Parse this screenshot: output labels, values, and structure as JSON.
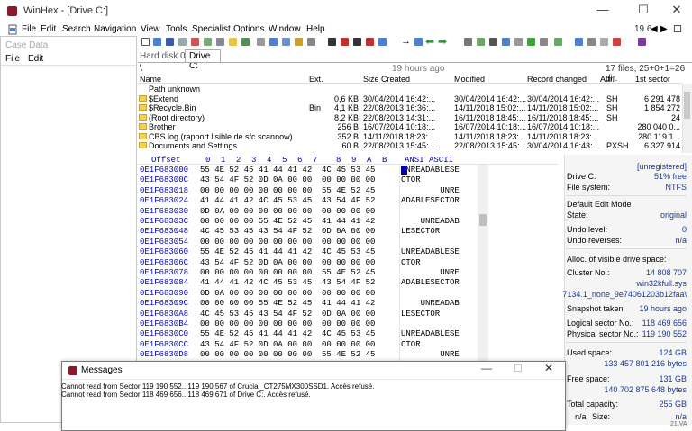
{
  "window": {
    "title": "WinHex - [Drive C:]",
    "minimize": "—",
    "maximize": "☐",
    "close": "✕"
  },
  "menu": [
    "File",
    "Edit",
    "Search",
    "Navigation",
    "View",
    "Tools",
    "Specialist",
    "Options",
    "Window",
    "Help"
  ],
  "version": "19.6",
  "case_data": {
    "title": "Case Data",
    "file": "File",
    "edit": "Edit"
  },
  "tabs": [
    "Hard disk 0",
    "Drive C:"
  ],
  "path": {
    "back": "\\",
    "time": "19 hours ago",
    "summary": "17 files, 25+0+1=26 dir."
  },
  "dir_columns": [
    "Name",
    "Ext.",
    "Size",
    "Created",
    "Modified",
    "Record changed",
    "Attr.",
    "1st sector"
  ],
  "dir_rows": [
    {
      "name": "Path unknown",
      "ext": "",
      "size": "",
      "created": "",
      "modified": "",
      "changed": "",
      "attr": "",
      "sector": "",
      "folder": false
    },
    {
      "name": "$Extend",
      "ext": "",
      "size": "0,6 KB",
      "created": "30/04/2014  16:42:...",
      "modified": "30/04/2014  16:42:...",
      "changed": "30/04/2014  16:42:...",
      "attr": "SH",
      "sector": "6 291 478",
      "folder": true
    },
    {
      "name": "$Recycle.Bin",
      "ext": "Bin",
      "size": "4,1 KB",
      "created": "22/08/2013  16:36:...",
      "modified": "14/11/2018  15:02:...",
      "changed": "14/11/2018  15:02:...",
      "attr": "SH",
      "sector": "1 854 272",
      "folder": true
    },
    {
      "name": "(Root directory)",
      "ext": "",
      "size": "8,2 KB",
      "created": "22/08/2013  14:31:...",
      "modified": "16/11/2018  18:45:...",
      "changed": "16/11/2018  18:45:...",
      "attr": "SH",
      "sector": "24",
      "folder": true
    },
    {
      "name": "Brother",
      "ext": "",
      "size": "256 B",
      "created": "16/07/2014  10:18:...",
      "modified": "16/07/2014  10:18:...",
      "changed": "16/07/2014  10:18:...",
      "attr": "",
      "sector": "280 040 0...",
      "folder": true
    },
    {
      "name": "CBS log (rapport lisible de sfc scannow)",
      "ext": "",
      "size": "352 B",
      "created": "14/11/2018  18:23:...",
      "modified": "14/11/2018  18:23:...",
      "changed": "14/11/2018  18:23:...",
      "attr": "",
      "sector": "280 119 1...",
      "folder": true
    },
    {
      "name": "Documents and Settings",
      "ext": "",
      "size": "60 B",
      "created": "22/08/2013  15:45:...",
      "modified": "22/08/2013  15:45:...",
      "changed": "30/04/2014  16:43:...",
      "attr": "PXSH",
      "sector": "6 327 914",
      "folder": true
    }
  ],
  "hex_header": {
    "offset": "Offset",
    "cols": [
      "0",
      "1",
      "2",
      "3",
      "4",
      "5",
      "6",
      "7",
      "8",
      "9",
      "A",
      "B"
    ],
    "ascii": "ANSI ASCII"
  },
  "hex_rows": [
    {
      "off": "0E1F683000",
      "hex": "55 4E 52 45 41 44 41 42  4C 45 53 45",
      "asc": "UNREADABLESE"
    },
    {
      "off": "0E1F68300C",
      "hex": "43 54 4F 52 0D 0A 00 00  00 00 00 00",
      "asc": "CTOR"
    },
    {
      "off": "0E1F683018",
      "hex": "00 00 00 00 00 00 00 00  55 4E 52 45",
      "asc": "        UNRE"
    },
    {
      "off": "0E1F683024",
      "hex": "41 44 41 42 4C 45 53 45  43 54 4F 52",
      "asc": "ADABLESECTOR"
    },
    {
      "off": "0E1F683030",
      "hex": "0D 0A 00 00 00 00 00 00  00 00 00 00",
      "asc": ""
    },
    {
      "off": "0E1F68303C",
      "hex": "00 00 00 00 55 4E 52 45  41 44 41 42",
      "asc": "    UNREADAB"
    },
    {
      "off": "0E1F683048",
      "hex": "4C 45 53 45 43 54 4F 52  0D 0A 00 00",
      "asc": "LESECTOR"
    },
    {
      "off": "0E1F683054",
      "hex": "00 00 00 00 00 00 00 00  00 00 00 00",
      "asc": ""
    },
    {
      "off": "0E1F683060",
      "hex": "55 4E 52 45 41 44 41 42  4C 45 53 45",
      "asc": "UNREADABLESE"
    },
    {
      "off": "0E1F68306C",
      "hex": "43 54 4F 52 0D 0A 00 00  00 00 00 00",
      "asc": "CTOR"
    },
    {
      "off": "0E1F683078",
      "hex": "00 00 00 00 00 00 00 00  55 4E 52 45",
      "asc": "        UNRE"
    },
    {
      "off": "0E1F683084",
      "hex": "41 44 41 42 4C 45 53 45  43 54 4F 52",
      "asc": "ADABLESECTOR"
    },
    {
      "off": "0E1F683090",
      "hex": "0D 0A 00 00 00 00 00 00  00 00 00 00",
      "asc": ""
    },
    {
      "off": "0E1F68309C",
      "hex": "00 00 00 00 55 4E 52 45  41 44 41 42",
      "asc": "    UNREADAB"
    },
    {
      "off": "0E1F6830A8",
      "hex": "4C 45 53 45 43 54 4F 52  0D 0A 00 00",
      "asc": "LESECTOR"
    },
    {
      "off": "0E1F6830B4",
      "hex": "00 00 00 00 00 00 00 00  00 00 00 00",
      "asc": ""
    },
    {
      "off": "0E1F6830C0",
      "hex": "55 4E 52 45 41 44 41 42  4C 45 53 45",
      "asc": "UNREADABLESE"
    },
    {
      "off": "0E1F6830CC",
      "hex": "43 54 4F 52 0D 0A 00 00  00 00 00 00",
      "asc": "CTOR"
    },
    {
      "off": "0E1F6830D8",
      "hex": "00 00 00 00 00 00 00 00  55 4E 52 45",
      "asc": "        UNRE"
    }
  ],
  "info": {
    "unregistered": "[unregistered]",
    "drive_label": "Drive C:",
    "drive_free": "51% free",
    "fs_label": "File system:",
    "fs_value": "NTFS",
    "edit_mode_label": "Default Edit Mode",
    "state_label": "State:",
    "state_value": "original",
    "undo_level_label": "Undo level:",
    "undo_level_value": "0",
    "undo_reverses_label": "Undo reverses:",
    "undo_reverses_value": "n/a",
    "alloc_label": "Alloc. of visible drive space:",
    "cluster_label": "Cluster No.:",
    "cluster_value": "14 808 707",
    "file1": "win32kfull.sys",
    "file2": "7134.1_none_9e74061203b12faa\\",
    "snapshot_label": "Snapshot taken",
    "snapshot_value": "19 hours ago",
    "logical_label": "Logical sector No.:",
    "logical_value": "118 469 656",
    "physical_label": "Physical sector No.:",
    "physical_value": "119 190 552",
    "used_label": "Used space:",
    "used_value": "124 GB",
    "used_bytes": "133 457 801 216 bytes",
    "free_label": "Free space:",
    "free_value": "131 GB",
    "free_bytes": "140 702 875 648 bytes",
    "total_label": "Total capacity:",
    "total_value": "255 GB",
    "size_na": "n/a",
    "size_label": "Size:",
    "size_value": "n/a"
  },
  "messages": {
    "title": "Messages",
    "minimize": "—",
    "maximize": "☐",
    "close": "✕",
    "lines": [
      "Cannot read from Sector 119 190 552...119 190 567 of Crucial_CT275MX300SSD1. Accès refusé.",
      "Cannot read from Sector 118 469 656...118 469 671 of Drive C:. Accès refusé."
    ]
  },
  "taskbar_hint": "21 VA",
  "colors": {
    "offset_blue": "#0000c0",
    "value_blue": "#1a3a8f",
    "folder_yellow": "#f2cf55",
    "app_red": "#8a1a2a"
  }
}
